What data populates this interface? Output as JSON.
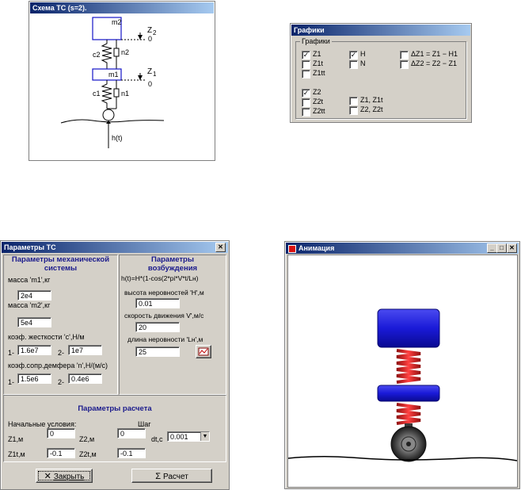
{
  "scheme_window": {
    "title": "Схема ТС (s=2).",
    "labels": {
      "m2": "m2",
      "m1": "m1",
      "c2": "c2",
      "c1": "c1",
      "n2": "n2",
      "n1": "n1",
      "z2": "Z",
      "z2_sub": "2",
      "z2_zero": "0",
      "z1": "Z",
      "z1_sub": "1",
      "z1_zero": "0",
      "h": "h(t)"
    }
  },
  "graphs_window": {
    "title": "Графики",
    "group_label": "Графики",
    "items": [
      {
        "label": "Z1",
        "checked": true
      },
      {
        "label": "Z1t",
        "checked": false
      },
      {
        "label": "Z1tt",
        "checked": false
      },
      {
        "label": "Z2",
        "checked": true
      },
      {
        "label": "Z2t",
        "checked": false
      },
      {
        "label": "Z2tt",
        "checked": false
      },
      {
        "label": "H",
        "checked": true
      },
      {
        "label": "N",
        "checked": false
      },
      {
        "label": "Z1, Z1t",
        "checked": false
      },
      {
        "label": "Z2, Z2t",
        "checked": false
      },
      {
        "label": "ΔZ1 = Z1 − H1",
        "checked": false
      },
      {
        "label": "ΔZ2 = Z2 − Z1",
        "checked": false
      }
    ]
  },
  "params_window": {
    "title": "Параметры ТС",
    "close_glyph": "✕",
    "mech_title_1": "Параметры механической",
    "mech_title_2": "системы",
    "mass_m1_label": "масса 'm1',кг",
    "mass_m1": "2e4",
    "mass_m2_label": "масса 'm2',кг",
    "mass_m2": "5e4",
    "stiff_label": "коэф. жесткости 'c',Н/м",
    "c1_prefix": "1-",
    "c1": "1.6e7",
    "c2_prefix": "2-",
    "c2": "1e7",
    "damp_label": "коэф.сопр.демфера 'n',Н/(м/с)",
    "n1_prefix": "1-",
    "n1": "1.5e6",
    "n2_prefix": "2-",
    "n2": "0.4e6",
    "exc_title_1": "Параметры",
    "exc_title_2": "возбуждения",
    "formula": "h(t)=H*(1-cos(2*pi*V*t/Lн)",
    "height_label": "высота неровностей 'H',м",
    "height": "0.01",
    "speed_label": "скорость движения V',м/с",
    "speed": "20",
    "length_label": "длина неровности 'Lн',м",
    "length": "25",
    "calc_title": "Параметры расчета",
    "init_label": "Начальные условия:",
    "step_label": "Шаг",
    "z1_label": "Z1,м",
    "z1": "0",
    "z2_label": "Z2,м",
    "z2": "0",
    "z1t_label": "Z1t,м",
    "z1t": "-0.1",
    "z2t_label": "Z2t,м",
    "z2t": "-0.1",
    "dt_label": "dt,c",
    "dt": "0.001",
    "close_label": "Закрыть",
    "calc_label": "Расчет",
    "close_icon": "✕",
    "calc_icon": "Σ"
  },
  "anim_window": {
    "title": "Анимация",
    "min": "_",
    "max": "□",
    "close": "✕",
    "colors": {
      "body": "#1a1ad8",
      "spring": "#d81010",
      "wheel": "#3a3a3a"
    }
  }
}
